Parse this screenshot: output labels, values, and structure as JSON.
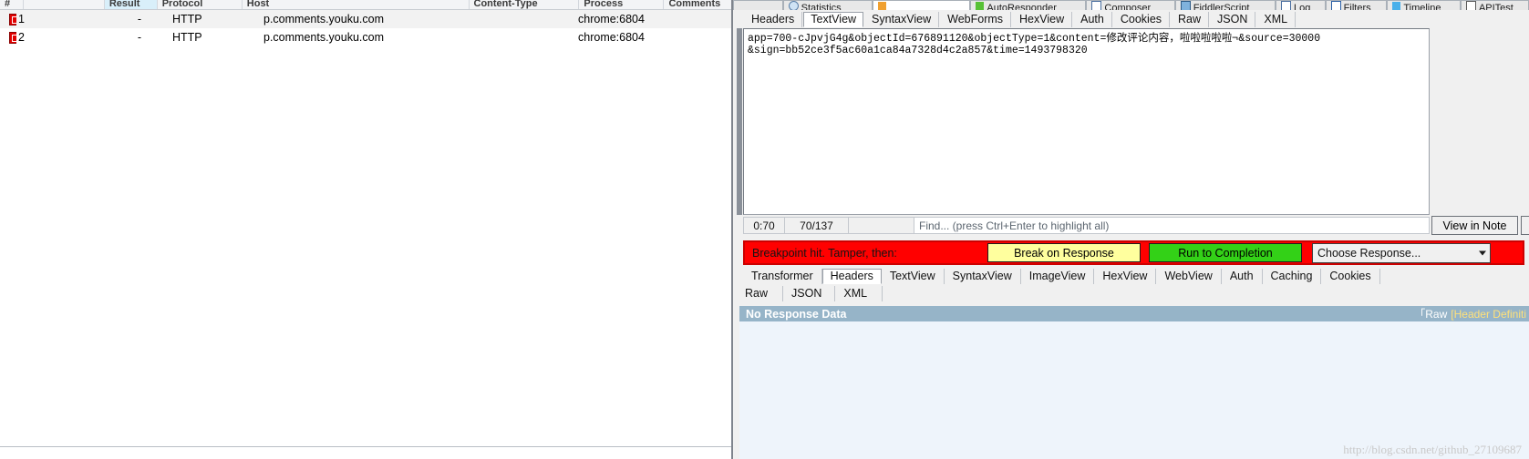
{
  "left_pane": {
    "columns": [
      {
        "key": "icon",
        "label": "#"
      },
      {
        "key": "id",
        "label": ""
      },
      {
        "key": "result",
        "label": "Result",
        "selected": true
      },
      {
        "key": "proto",
        "label": "Protocol"
      },
      {
        "key": "host",
        "label": "Host"
      },
      {
        "key": "ctype",
        "label": "Content-Type"
      },
      {
        "key": "proc",
        "label": "Process"
      },
      {
        "key": "comments",
        "label": "Comments"
      }
    ],
    "rows": [
      {
        "icon": "breakpoint-icon",
        "id": "1",
        "result": "-",
        "protocol": "HTTP",
        "host": "p.comments.youku.com",
        "content_type": "",
        "process": "chrome:6804",
        "comments": ""
      },
      {
        "icon": "breakpoint-icon",
        "id": "2",
        "result": "-",
        "protocol": "HTTP",
        "host": "p.comments.youku.com",
        "content_type": "",
        "process": "chrome:6804",
        "comments": ""
      }
    ]
  },
  "main_tabs": [
    {
      "label": "Statistics",
      "icon": "chart-icon",
      "active": false
    },
    {
      "label": "",
      "icon": "inspectors-icon",
      "active": true
    },
    {
      "label": "AutoResponder",
      "icon": "pencil-icon",
      "active": false
    },
    {
      "label": "Composer",
      "icon": "compose-icon",
      "active": false
    },
    {
      "label": "FiddlerScript",
      "icon": "script-icon",
      "active": false
    },
    {
      "label": "Log",
      "icon": "log-icon",
      "active": false
    },
    {
      "label": "Filters",
      "icon": "filter-icon",
      "active": false
    },
    {
      "label": "Timeline",
      "icon": "timeline-icon",
      "active": false
    },
    {
      "label": "APITest",
      "icon": "apitest-icon",
      "active": false
    }
  ],
  "request_tabs": [
    {
      "label": "Headers",
      "active": false
    },
    {
      "label": "TextView",
      "active": true
    },
    {
      "label": "SyntaxView",
      "active": false
    },
    {
      "label": "WebForms",
      "active": false
    },
    {
      "label": "HexView",
      "active": false
    },
    {
      "label": "Auth",
      "active": false
    },
    {
      "label": "Cookies",
      "active": false
    },
    {
      "label": "Raw",
      "active": false
    },
    {
      "label": "JSON",
      "active": false
    },
    {
      "label": "XML",
      "active": false
    }
  ],
  "request_body": {
    "line1_prefix": "app=700-cJpvjG4g&objectId=676891120&objectType=1&content=修改评论内容，啦啦啦啦啦",
    "caret": "⌐",
    "line1_suffix": "&source=30000",
    "line2": "&sign=bb52ce3f5ac60a1ca84a7328d4c2a857&time=1493798320"
  },
  "find_strip": {
    "position": "0:70",
    "count": "70/137",
    "blank": "",
    "find_placeholder": "Find... (press Ctrl+Enter to highlight all)"
  },
  "find_buttons": {
    "view_in_notepad": "View in Note",
    "more": ".."
  },
  "breakpoint_bar": {
    "message": "Breakpoint hit. Tamper, then:",
    "break_on_response": "Break on Response",
    "break_on_response_accel": "B",
    "run_to_completion": "Run to Completion",
    "run_to_completion_accel": "C",
    "choose_response": "Choose Response...",
    "bar_color": "#ff0000",
    "yellow_button_color": "#ffff9e",
    "green_button_color": "#33d117"
  },
  "response_tabs_row1": [
    {
      "label": "Transformer",
      "active": false
    },
    {
      "label": "Headers",
      "active": true
    },
    {
      "label": "TextView",
      "active": false
    },
    {
      "label": "SyntaxView",
      "active": false
    },
    {
      "label": "ImageView",
      "active": false
    },
    {
      "label": "HexView",
      "active": false
    },
    {
      "label": "WebView",
      "active": false
    },
    {
      "label": "Auth",
      "active": false
    },
    {
      "label": "Caching",
      "active": false
    },
    {
      "label": "Cookies",
      "active": false
    }
  ],
  "response_tabs_row2": [
    {
      "label": "Raw",
      "active": false
    },
    {
      "label": "JSON",
      "active": false
    },
    {
      "label": "XML",
      "active": false
    }
  ],
  "no_response": {
    "title": "No Response Data",
    "raw_label": "「Raw",
    "header_label": "[Header Definiti",
    "banner_color": "#96b4c8",
    "header_color": "#ffe17a"
  },
  "watermark": "http://blog.csdn.net/github_27109687"
}
